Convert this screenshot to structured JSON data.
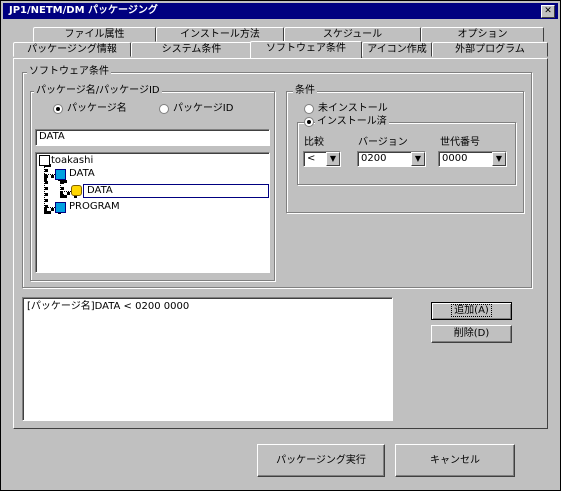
{
  "window": {
    "title": "JP1/NETM/DM パッケージング",
    "close_glyph": "✕"
  },
  "tabs_back": [
    "ファイル属性",
    "インストール方法",
    "スケジュール",
    "オプション"
  ],
  "tabs_front": [
    "パッケージング情報",
    "システム条件",
    "ソフトウェア条件",
    "アイコン作成",
    "外部プログラム"
  ],
  "software_group": {
    "label": "ソフトウェア条件",
    "pkg_group": {
      "label": "パッケージ名/パッケージID",
      "radio_name": "パッケージ名",
      "radio_id": "パッケージID",
      "selected": "パッケージ名",
      "input_value": "DATA",
      "tree": {
        "root": "toakashi",
        "n1": "DATA",
        "n1_child": "DATA",
        "n2": "PROGRAM"
      }
    }
  },
  "condition_group": {
    "label": "条件",
    "radio_not_installed": "未インストール",
    "radio_installed": "インストール済",
    "selected": "インストール済",
    "compare_label": "比較",
    "compare_value": "<",
    "version_label": "バージョン",
    "version_value": "0200",
    "generation_label": "世代番号",
    "generation_value": "0000"
  },
  "result_list": [
    "[パッケージ名]DATA < 0200 0000"
  ],
  "buttons": {
    "add": "追加(A)",
    "delete": "削除(D)",
    "run": "パッケージング実行",
    "cancel": "キャンセル"
  },
  "icons": {
    "dropdown": "▼"
  }
}
